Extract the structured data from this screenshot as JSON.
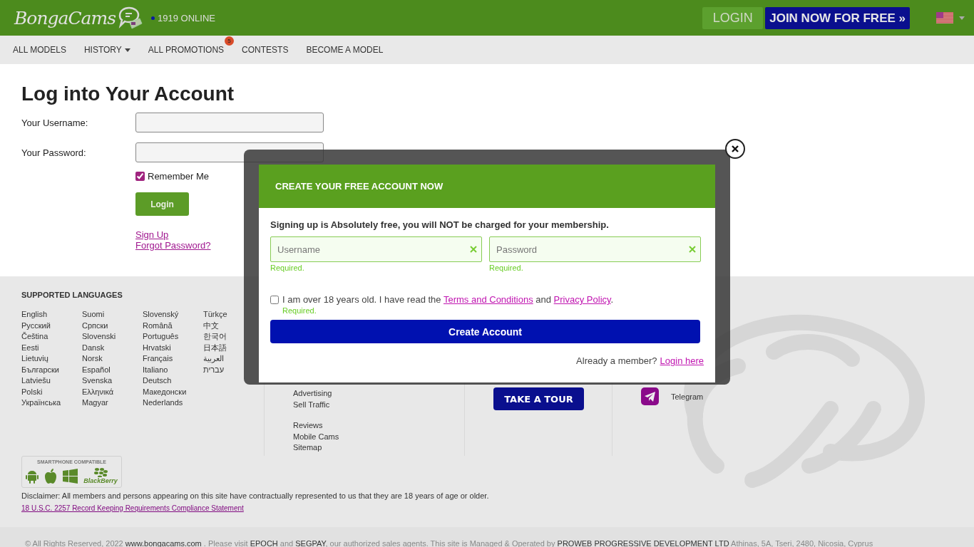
{
  "header": {
    "logo": "BongaCams",
    "online": "1919 ONLINE",
    "login_button": "LOGIN",
    "join_button": "JOIN NOW FOR FREE »"
  },
  "nav": [
    {
      "label": "ALL MODELS",
      "dropdown": false
    },
    {
      "label": "HISTORY",
      "dropdown": true
    },
    {
      "label": "ALL PROMOTIONS",
      "dropdown": false,
      "badge": "5"
    },
    {
      "label": "CONTESTS",
      "dropdown": false
    },
    {
      "label": "BECOME A MODEL",
      "dropdown": false
    }
  ],
  "login": {
    "title": "Log into Your Account",
    "fields": [
      {
        "label": "Your Username:"
      },
      {
        "label": "Your Password:"
      }
    ],
    "remember": {
      "label": "Remember Me",
      "checked": true
    },
    "button": "Login",
    "links": [
      "Sign Up",
      "Forgot Password?"
    ]
  },
  "footer": {
    "languages_title": "SUPPORTED LANGUAGES",
    "languages": [
      [
        "English",
        "Русский",
        "Čeština",
        "Eesti",
        "Lietuvių",
        "Български",
        "Latviešu",
        "Polski",
        "Українська"
      ],
      [
        "Suomi",
        "Српски",
        "Slovenski",
        "Dansk",
        "Norsk",
        "Español",
        "Svenska",
        "Ελληνικά",
        "Magyar"
      ],
      [
        "Slovenský",
        "Română",
        "Português",
        "Hrvatski",
        "Français",
        "Italiano",
        "Deutsch",
        "Македонски",
        "Nederlands"
      ],
      [
        "Türkçe",
        "中文",
        "한국어",
        "日本語",
        "العربية",
        "עברית"
      ]
    ],
    "links": [
      [
        "Advertising",
        "Sell Traffic"
      ],
      [
        "Reviews",
        "Mobile Cams",
        "Sitemap"
      ]
    ],
    "tour_button": "TAKE A TOUR",
    "social": "Telegram",
    "smartphone": {
      "title": "SMARTPHONE COMPATIBLE",
      "blackberry": "BlackBerry"
    },
    "disclaimer": "Disclaimer: All members and persons appearing on this site have contractually represented to us that they are 18 years of age or older.",
    "compliance_link": "18 U.S.C. 2257 Record Keeping Requirements Compliance Statement"
  },
  "bottom": [
    {
      "kind": "plain",
      "text": "© All Rights Reserved, 2022 "
    },
    {
      "kind": "link",
      "text": "www.bongacams.com"
    },
    {
      "kind": "plain",
      "text": " . Please visit "
    },
    {
      "kind": "link",
      "text": "EPOCH"
    },
    {
      "kind": "plain",
      "text": " and "
    },
    {
      "kind": "link",
      "text": "SEGPAY"
    },
    {
      "kind": "plain",
      "text": ", our authorized sales agents. This site is Managed & Operated by "
    },
    {
      "kind": "link",
      "text": "PROWEB PROGRESSIVE DEVELOPMENT LTD"
    },
    {
      "kind": "plain",
      "text": " Athinas, 5A, Tseri, 2480, Nicosia, Cyprus"
    }
  ],
  "modal": {
    "title": "CREATE YOUR FREE ACCOUNT NOW",
    "intro": "Signing up is Absolutely free, you will NOT be charged for your membership.",
    "fields": [
      {
        "placeholder": "Username",
        "error": "Required."
      },
      {
        "placeholder": "Password",
        "error": "Required."
      }
    ],
    "terms": {
      "checked": false,
      "error": "Required.",
      "parts": [
        {
          "kind": "plain",
          "text": "I am over 18 years old. I have read the "
        },
        {
          "kind": "link",
          "text": "Terms and Conditions"
        },
        {
          "kind": "plain",
          "text": " and "
        },
        {
          "kind": "link",
          "text": "Privacy Policy"
        },
        {
          "kind": "plain",
          "text": "."
        }
      ]
    },
    "button": "Create Account",
    "member_text": "Already a member?",
    "member_link": "Login here"
  }
}
